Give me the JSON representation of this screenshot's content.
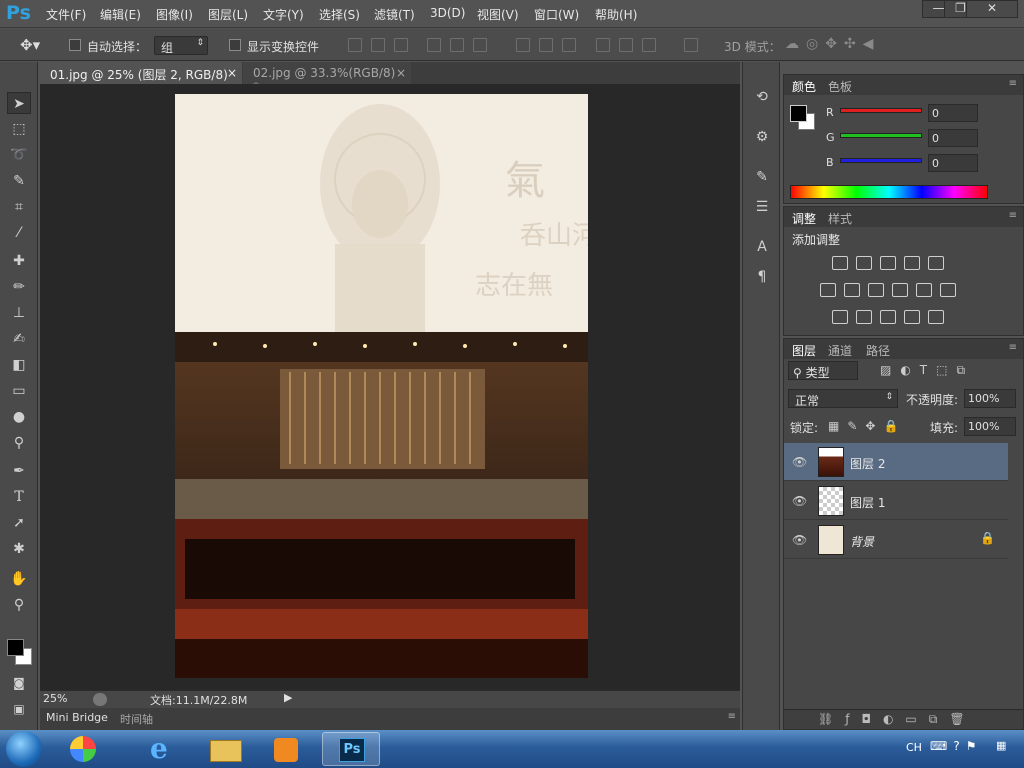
{
  "app": {
    "logo": "Ps"
  },
  "menu": [
    "文件(F)",
    "编辑(E)",
    "图像(I)",
    "图层(L)",
    "文字(Y)",
    "选择(S)",
    "滤镜(T)",
    "3D(D)",
    "视图(V)",
    "窗口(W)",
    "帮助(H)"
  ],
  "window_buttons": {
    "minimize": "—",
    "restore": "❐",
    "close": "✕"
  },
  "options": {
    "auto_select_label": "自动选择：",
    "auto_select_value": "组",
    "show_transform_label": "显示变换控件",
    "mode_3d_label": "3D 模式："
  },
  "tabs": [
    {
      "label": "01.jpg @ 25% (图层 2, RGB/8) *",
      "close": "×",
      "active": true
    },
    {
      "label": "02.jpg @ 33.3%(RGB/8) *",
      "close": "×",
      "active": false
    }
  ],
  "status": {
    "zoom": "25%",
    "doc": "文档:11.1M/22.8M"
  },
  "bottom_tabs": [
    "Mini Bridge",
    "时间轴"
  ],
  "color_panel": {
    "tabs": [
      "颜色",
      "色板"
    ],
    "channels": [
      {
        "label": "R",
        "value": "0",
        "color": "#e02020"
      },
      {
        "label": "G",
        "value": "0",
        "color": "#20c020"
      },
      {
        "label": "B",
        "value": "0",
        "color": "#2020e0"
      }
    ]
  },
  "adjust_panel": {
    "tabs": [
      "调整",
      "样式"
    ],
    "title": "添加调整"
  },
  "layers_panel": {
    "tabs": [
      "图层",
      "通道",
      "路径"
    ],
    "filter": "类型",
    "blend": "正常",
    "opacity_label": "不透明度:",
    "opacity": "100%",
    "lock_label": "锁定:",
    "fill_label": "填充:",
    "fill": "100%",
    "layers": [
      {
        "name": "图层 2",
        "selected": true
      },
      {
        "name": "图层 1",
        "selected": false
      },
      {
        "name": "背景",
        "selected": false,
        "locked": true
      }
    ]
  },
  "tray": {
    "lang": "CH"
  },
  "colors": {
    "accent": "#2fa3e0",
    "selected_layer": "#596a83"
  }
}
